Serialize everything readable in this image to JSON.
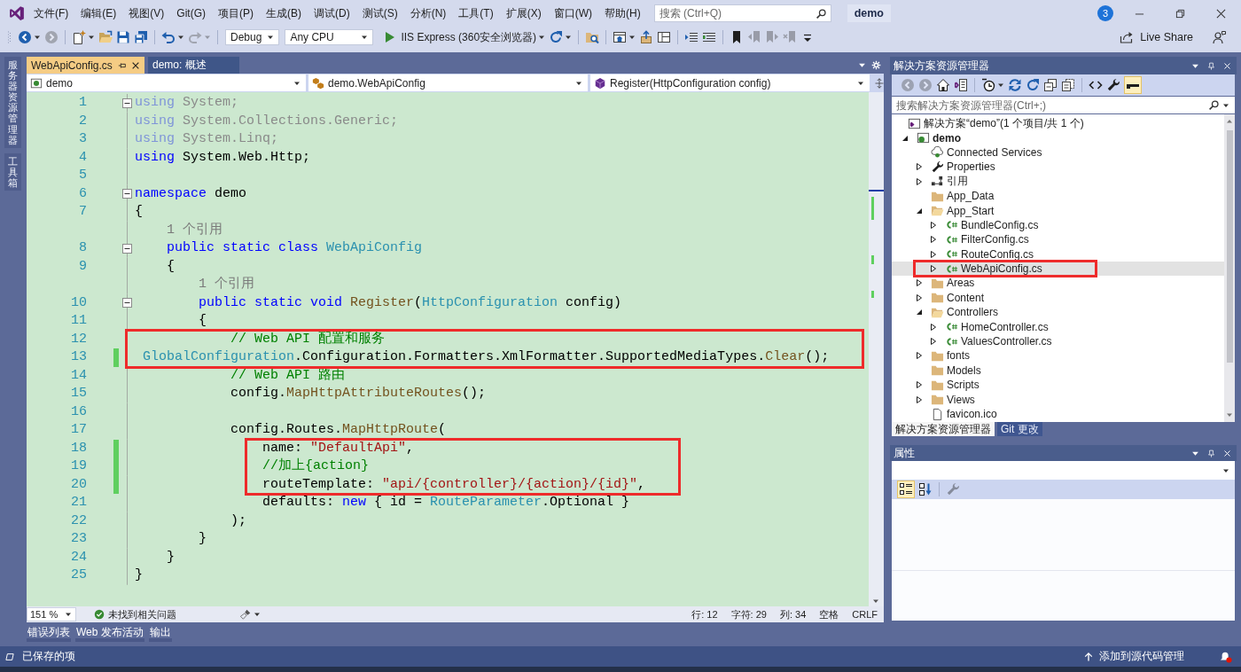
{
  "menu_bar": {
    "items": [
      "文件(F)",
      "编辑(E)",
      "视图(V)",
      "Git(G)",
      "项目(P)",
      "生成(B)",
      "调试(D)",
      "测试(S)",
      "分析(N)",
      "工具(T)",
      "扩展(X)",
      "窗口(W)",
      "帮助(H)"
    ],
    "search": {
      "placeholder": "搜索 (Ctrl+Q)"
    },
    "solution_name": "demo",
    "notifications": "3"
  },
  "toolbar": {
    "groups": [
      [
        {
          "kind": "back",
          "disabled": false,
          "dropdown": true
        },
        {
          "kind": "forward",
          "disabled": true
        }
      ],
      [
        {
          "kind": "new-item",
          "disabled": false,
          "dropdown": true
        },
        {
          "kind": "open",
          "disabled": false
        },
        {
          "kind": "save",
          "disabled": false
        },
        {
          "kind": "save-all",
          "disabled": false
        }
      ],
      [
        {
          "kind": "undo",
          "disabled": false,
          "dropdown": true
        },
        {
          "kind": "redo",
          "disabled": true,
          "dropdown": true
        }
      ],
      [
        {
          "kind": "combo",
          "value": "Debug"
        },
        {
          "kind": "combo",
          "value": "Any CPU"
        },
        {
          "kind": "run",
          "label": "IIS Express (360安全浏览器)",
          "dropdown": true
        },
        {
          "kind": "refresh",
          "disabled": false,
          "dropdown": true
        }
      ],
      [
        {
          "kind": "folder-search",
          "disabled": false
        }
      ],
      [
        {
          "kind": "browser-link",
          "disabled": false,
          "dropdown": true
        },
        {
          "kind": "publish",
          "disabled": false
        },
        {
          "kind": "layout",
          "disabled": false
        }
      ],
      [
        {
          "kind": "indent",
          "disabled": false
        },
        {
          "kind": "comment",
          "disabled": false
        }
      ],
      [
        {
          "kind": "bookmark",
          "disabled": false
        },
        {
          "kind": "bookmark-prev",
          "disabled": true
        },
        {
          "kind": "bookmark-next",
          "disabled": true
        },
        {
          "kind": "bookmark-clear",
          "disabled": true
        },
        {
          "kind": "overflow",
          "disabled": false
        }
      ]
    ],
    "live_share": "Live Share"
  },
  "side_tabs": [
    "服务器资源管理器",
    "工具箱"
  ],
  "editor": {
    "tabs": [
      {
        "label": "WebApiConfig.cs",
        "selected": true
      },
      {
        "label": "demo: 概述",
        "selected": false
      }
    ],
    "nav": [
      {
        "kind": "project",
        "value": "demo"
      },
      {
        "kind": "class",
        "value": "demo.WebApiConfig"
      },
      {
        "kind": "method",
        "value": "Register(HttpConfiguration config)"
      }
    ],
    "lines": [
      {
        "kind": "code",
        "number": "1",
        "expanded": true,
        "changed": false,
        "tokens": [
          {
            "text": "using",
            "kind": "dim-keyword"
          },
          {
            "text": " System;",
            "kind": "dim"
          }
        ]
      },
      {
        "kind": "code",
        "number": "2",
        "changed": false,
        "tokens": [
          {
            "text": "using",
            "kind": "dim-keyword"
          },
          {
            "text": " System.Collections.Generic;",
            "kind": "dim"
          }
        ]
      },
      {
        "kind": "code",
        "number": "3",
        "changed": false,
        "tokens": [
          {
            "text": "using",
            "kind": "dim-keyword"
          },
          {
            "text": " System.Linq;",
            "kind": "dim"
          }
        ]
      },
      {
        "kind": "code",
        "number": "4",
        "changed": false,
        "tokens": [
          {
            "text": "using",
            "kind": "keyword"
          },
          {
            "text": " System.Web.Http;",
            "kind": "plain"
          }
        ]
      },
      {
        "kind": "code",
        "number": "5",
        "changed": false
      },
      {
        "kind": "code",
        "number": "6",
        "expanded": true,
        "changed": false,
        "tokens": [
          {
            "text": "namespace",
            "kind": "keyword"
          },
          {
            "text": " demo",
            "kind": "plain"
          }
        ]
      },
      {
        "kind": "code",
        "number": "7",
        "changed": false,
        "tokens": [
          {
            "text": "{",
            "kind": "plain"
          }
        ]
      },
      {
        "kind": "codelens",
        "text": "    1 个引用"
      },
      {
        "kind": "code",
        "number": "8",
        "expanded": true,
        "changed": false,
        "tokens": [
          {
            "text": "    public static class ",
            "kind": "keyword"
          },
          {
            "text": "WebApiConfig",
            "kind": "type"
          }
        ]
      },
      {
        "kind": "code",
        "number": "9",
        "changed": false,
        "tokens": [
          {
            "text": "    {",
            "kind": "plain"
          }
        ]
      },
      {
        "kind": "codelens",
        "text": "        1 个引用"
      },
      {
        "kind": "code",
        "number": "10",
        "expanded": true,
        "changed": false,
        "tokens": [
          {
            "text": "        public static void ",
            "kind": "keyword"
          },
          {
            "text": "Register",
            "kind": "method"
          },
          {
            "text": "(",
            "kind": "plain"
          },
          {
            "text": "HttpConfiguration",
            "kind": "type"
          },
          {
            "text": " config)",
            "kind": "plain"
          }
        ]
      },
      {
        "kind": "code",
        "number": "11",
        "changed": false,
        "tokens": [
          {
            "text": "        {",
            "kind": "plain"
          }
        ]
      },
      {
        "kind": "code",
        "number": "12",
        "changed": false,
        "boxed": true,
        "tokens": [
          {
            "text": "            // Web API 配置和服务",
            "kind": "comment"
          }
        ]
      },
      {
        "kind": "code",
        "number": "13",
        "changed": true,
        "boxed": true,
        "tokens": [
          {
            "text": " GlobalConfiguration",
            "kind": "type"
          },
          {
            "text": ".Configuration.Formatters.XmlFormatter.SupportedMediaTypes.",
            "kind": "plain"
          },
          {
            "text": "Clear",
            "kind": "method"
          },
          {
            "text": "();",
            "kind": "plain"
          }
        ]
      },
      {
        "kind": "code",
        "number": "14",
        "changed": false,
        "tokens": [
          {
            "text": "            // Web API 路由",
            "kind": "comment"
          }
        ]
      },
      {
        "kind": "code",
        "number": "15",
        "changed": false,
        "tokens": [
          {
            "text": "            config.",
            "kind": "plain"
          },
          {
            "text": "MapHttpAttributeRoutes",
            "kind": "method"
          },
          {
            "text": "();",
            "kind": "plain"
          }
        ]
      },
      {
        "kind": "code",
        "number": "16",
        "changed": false
      },
      {
        "kind": "code",
        "number": "17",
        "changed": false,
        "tokens": [
          {
            "text": "            config.Routes.",
            "kind": "plain"
          },
          {
            "text": "MapHttpRoute",
            "kind": "method"
          },
          {
            "text": "(",
            "kind": "plain"
          }
        ]
      },
      {
        "kind": "code",
        "number": "18",
        "changed": true,
        "boxed": true,
        "tokens": [
          {
            "text": "                name: ",
            "kind": "plain"
          },
          {
            "text": "\"DefaultApi\"",
            "kind": "string"
          },
          {
            "text": ",",
            "kind": "plain"
          }
        ]
      },
      {
        "kind": "code",
        "number": "19",
        "changed": true,
        "boxed": true,
        "tokens": [
          {
            "text": "                //加上{action}",
            "kind": "comment"
          }
        ]
      },
      {
        "kind": "code",
        "number": "20",
        "changed": true,
        "boxed": true,
        "tokens": [
          {
            "text": "                routeTemplate: ",
            "kind": "plain"
          },
          {
            "text": "\"api/{controller}/{action}/{id}\"",
            "kind": "string"
          },
          {
            "text": ",",
            "kind": "plain"
          }
        ]
      },
      {
        "kind": "code",
        "number": "21",
        "changed": false,
        "tokens": [
          {
            "text": "                defaults: ",
            "kind": "plain"
          },
          {
            "text": "new",
            "kind": "keyword"
          },
          {
            "text": " { id = ",
            "kind": "plain"
          },
          {
            "text": "RouteParameter",
            "kind": "type"
          },
          {
            "text": ".Optional }",
            "kind": "plain"
          }
        ]
      },
      {
        "kind": "code",
        "number": "22",
        "changed": false,
        "tokens": [
          {
            "text": "            );",
            "kind": "plain"
          }
        ]
      },
      {
        "kind": "code",
        "number": "23",
        "changed": false,
        "tokens": [
          {
            "text": "        }",
            "kind": "plain"
          }
        ]
      },
      {
        "kind": "code",
        "number": "24",
        "changed": false,
        "tokens": [
          {
            "text": "    }",
            "kind": "plain"
          }
        ]
      },
      {
        "kind": "code",
        "number": "25",
        "changed": false,
        "tokens": [
          {
            "text": "}",
            "kind": "plain"
          }
        ]
      }
    ],
    "status": {
      "zoom": "151 %",
      "issues": "未找到相关问题",
      "position": [
        "行: 12",
        "字符: 29",
        "列: 34",
        "空格",
        "CRLF"
      ]
    }
  },
  "output_tabs": [
    "错误列表",
    "Web 发布活动",
    "输出"
  ],
  "solution_explorer": {
    "title": "解决方案资源管理器",
    "toolbar": [
      [
        {
          "kind": "back",
          "disabled": true
        },
        {
          "kind": "forward",
          "disabled": true
        },
        {
          "kind": "home",
          "disabled": false
        },
        {
          "kind": "switch-views",
          "disabled": false
        }
      ],
      [
        {
          "kind": "history",
          "disabled": false,
          "dropdown": true
        },
        {
          "kind": "sync",
          "disabled": false
        },
        {
          "kind": "refresh",
          "disabled": false
        },
        {
          "kind": "collapse-all",
          "disabled": false
        },
        {
          "kind": "show-all-files",
          "disabled": false
        }
      ],
      [
        {
          "kind": "view-code",
          "disabled": false
        },
        {
          "kind": "wrench",
          "disabled": false
        },
        {
          "kind": "preview",
          "disabled": false,
          "pressed": true
        }
      ]
    ],
    "search": {
      "placeholder": "搜索解决方案资源管理器(Ctrl+;)"
    },
    "tree": [
      {
        "label": "解决方案“demo”(1 个项目/共 1 个)",
        "kind": "solution",
        "selected": false,
        "children": [
          {
            "label": "demo",
            "kind": "project",
            "expanded": true,
            "selected": false,
            "children": [
              {
                "label": "Connected Services",
                "kind": "connected",
                "selected": false
              },
              {
                "label": "Properties",
                "kind": "properties",
                "expanded": false,
                "selected": false
              },
              {
                "label": "引用",
                "kind": "references",
                "expanded": false,
                "selected": false
              },
              {
                "label": "App_Data",
                "kind": "folder",
                "selected": false
              },
              {
                "label": "App_Start",
                "kind": "folder",
                "expanded": true,
                "selected": false,
                "children": [
                  {
                    "label": "BundleConfig.cs",
                    "kind": "cs-file",
                    "expanded": false,
                    "selected": false
                  },
                  {
                    "label": "FilterConfig.cs",
                    "kind": "cs-file",
                    "expanded": false,
                    "selected": false
                  },
                  {
                    "label": "RouteConfig.cs",
                    "kind": "cs-file",
                    "expanded": false,
                    "selected": false
                  },
                  {
                    "label": "WebApiConfig.cs",
                    "kind": "cs-file",
                    "expanded": false,
                    "selected": true,
                    "boxed": true
                  }
                ]
              },
              {
                "label": "Areas",
                "kind": "folder",
                "expanded": false,
                "selected": false
              },
              {
                "label": "Content",
                "kind": "folder",
                "expanded": false,
                "selected": false
              },
              {
                "label": "Controllers",
                "kind": "folder",
                "expanded": true,
                "selected": false,
                "children": [
                  {
                    "label": "HomeController.cs",
                    "kind": "cs-file",
                    "expanded": false,
                    "selected": false
                  },
                  {
                    "label": "ValuesController.cs",
                    "kind": "cs-file",
                    "expanded": false,
                    "selected": false
                  }
                ]
              },
              {
                "label": "fonts",
                "kind": "folder",
                "expanded": false,
                "selected": false
              },
              {
                "label": "Models",
                "kind": "folder",
                "selected": false
              },
              {
                "label": "Scripts",
                "kind": "folder",
                "expanded": false,
                "selected": false
              },
              {
                "label": "Views",
                "kind": "folder",
                "expanded": false,
                "selected": false
              },
              {
                "label": "favicon.ico",
                "kind": "file",
                "selected": false
              }
            ]
          }
        ]
      }
    ],
    "tabs": [
      {
        "label": "解决方案资源管理器",
        "selected": true
      },
      {
        "label": "Git 更改",
        "selected": false
      }
    ]
  },
  "properties": {
    "title": "属性",
    "toolbar": [
      [
        {
          "kind": "categorized",
          "disabled": false,
          "pressed": true
        },
        {
          "kind": "alphabetical",
          "disabled": false,
          "pressed": false
        }
      ],
      [
        {
          "kind": "wrench",
          "disabled": true
        }
      ]
    ]
  },
  "status_bar": {
    "message": "已保存的项",
    "action": "添加到源代码管理"
  }
}
